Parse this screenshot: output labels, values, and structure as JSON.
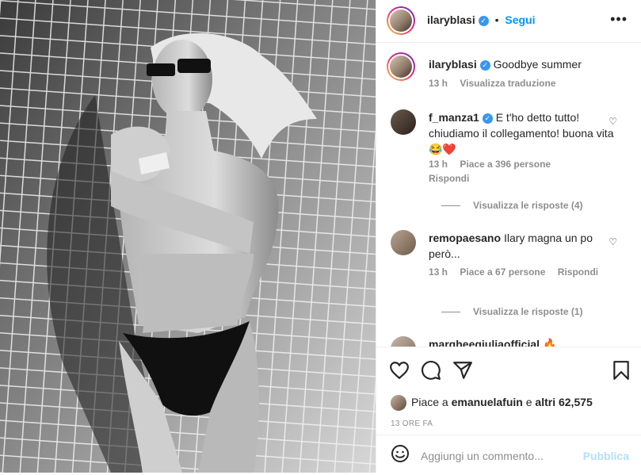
{
  "post": {
    "username": "ilaryblasi",
    "follow_label": "Segui",
    "caption": "Goodbye summer",
    "caption_time": "13 h",
    "translate_label": "Visualizza traduzione"
  },
  "comments": [
    {
      "username": "f_manza1",
      "verified": true,
      "text": "E t'ho detto tutto! chiudiamo il collegamento! buona vita 😂❤️",
      "time": "13 h",
      "likes": "Piace a 396 persone",
      "reply_label": "Rispondi",
      "view_replies": "Visualizza le risposte (4)"
    },
    {
      "username": "remopaesano",
      "verified": false,
      "text": "Ilary magna un po però...",
      "time": "13 h",
      "likes": "Piace a 67 persone",
      "reply_label": "Rispondi",
      "view_replies": "Visualizza le risposte (1)"
    },
    {
      "username": "margheegiuliaofficial",
      "verified": false,
      "text": "🔥"
    }
  ],
  "likes_summary": {
    "prefix": "Piace a",
    "user": "emanuelafuin",
    "connector": "e",
    "others": "altri 62,575"
  },
  "timestamp": "13 ORE FA",
  "comment_box": {
    "placeholder": "Aggiungi un commento...",
    "publish_label": "Pubblica"
  },
  "colors": {
    "accent": "#0095f6",
    "verified": "#3897f0",
    "muted": "#8e8e8e",
    "publish_disabled": "#b2dffc"
  },
  "icons": [
    "more-options-icon",
    "verified-icon",
    "heart-icon",
    "comment-icon",
    "share-icon",
    "save-icon",
    "emoji-icon"
  ]
}
